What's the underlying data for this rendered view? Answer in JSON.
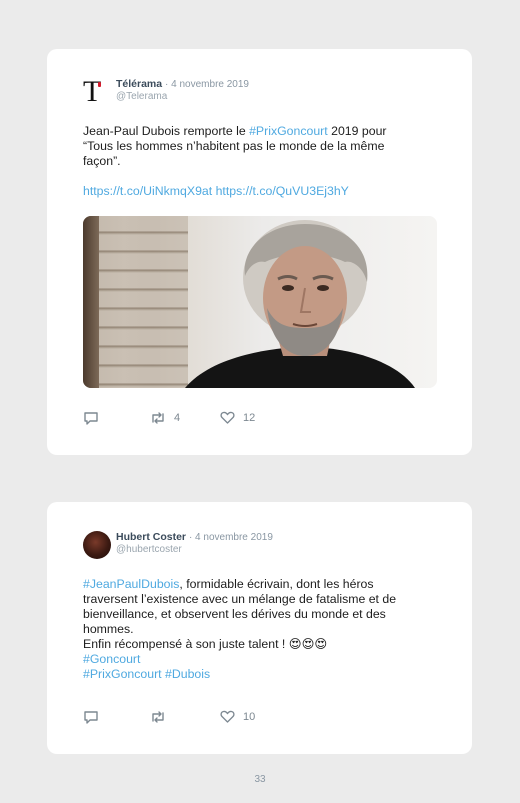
{
  "tweets": [
    {
      "author": "Télérama",
      "date": "· 4 novembre 2019",
      "handle": "@Telerama",
      "avatar_icon": "telerama-logo-icon",
      "lines": [
        "Jean-Paul Dubois remporte le ",
        "#PrixGoncourt",
        " 2019 pour",
        "“Tous les hommes n’habitent pas le monde de la même",
        "façon”."
      ],
      "links": [
        "https://t.co/UiNkmqX9at",
        "https://t.co/QuVU3Ej3hY"
      ],
      "reply_icon": "reply-icon",
      "retweet_count": "4",
      "like_count": "12"
    },
    {
      "author": "Hubert Coster",
      "date": "· 4 novembre 2019",
      "handle": "@hubertcoster",
      "avatar_icon": "user-avatar",
      "hashtag_lead": "#JeanPaulDubois",
      "line1_rest": ", formidable écrivain, dont les héros",
      "line2": "traversent l’existence avec un mélange de fatalisme et de",
      "line3": "bienveillance, et observent les dérives du monde et des",
      "line4": "hommes.",
      "line5": "Enfin récompensé à son juste talent ! ",
      "emoji": "😍😍😍",
      "hashtag_goncourt": "#Goncourt",
      "hashtag_prix": "#PrixGoncourt",
      "hashtag_dubois": "#Dubois",
      "retweet_count": "",
      "like_count": "10"
    }
  ],
  "page_number": "33",
  "colors": {
    "accent": "#4fa9e0",
    "background": "#ebebeb",
    "card": "#ffffff"
  }
}
